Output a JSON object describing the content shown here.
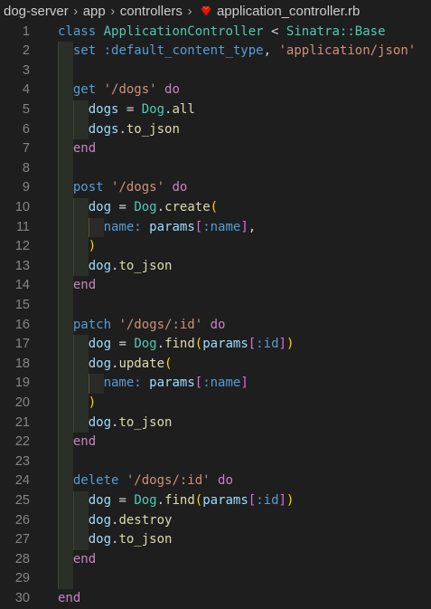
{
  "breadcrumb": {
    "items": [
      "dog-server",
      "app",
      "controllers",
      "application_controller.rb"
    ],
    "separator": ">",
    "file_icon": "ruby-gem-icon",
    "file_icon_color": "#e51400"
  },
  "editor": {
    "language": "ruby",
    "lines": [
      {
        "n": "1",
        "text": "class ApplicationController < Sinatra::Base"
      },
      {
        "n": "2",
        "text": "  set :default_content_type, 'application/json'"
      },
      {
        "n": "3",
        "text": ""
      },
      {
        "n": "4",
        "text": "  get '/dogs' do"
      },
      {
        "n": "5",
        "text": "    dogs = Dog.all"
      },
      {
        "n": "6",
        "text": "    dogs.to_json"
      },
      {
        "n": "7",
        "text": "  end"
      },
      {
        "n": "8",
        "text": ""
      },
      {
        "n": "9",
        "text": "  post '/dogs' do"
      },
      {
        "n": "10",
        "text": "    dog = Dog.create("
      },
      {
        "n": "11",
        "text": "      name: params[:name],"
      },
      {
        "n": "12",
        "text": "    )"
      },
      {
        "n": "13",
        "text": "    dog.to_json"
      },
      {
        "n": "14",
        "text": "  end"
      },
      {
        "n": "15",
        "text": ""
      },
      {
        "n": "16",
        "text": "  patch '/dogs/:id' do"
      },
      {
        "n": "17",
        "text": "    dog = Dog.find(params[:id])"
      },
      {
        "n": "18",
        "text": "    dog.update("
      },
      {
        "n": "19",
        "text": "      name: params[:name]"
      },
      {
        "n": "20",
        "text": "    )"
      },
      {
        "n": "21",
        "text": "    dog.to_json"
      },
      {
        "n": "22",
        "text": "  end"
      },
      {
        "n": "23",
        "text": ""
      },
      {
        "n": "24",
        "text": "  delete '/dogs/:id' do"
      },
      {
        "n": "25",
        "text": "    dog = Dog.find(params[:id])"
      },
      {
        "n": "26",
        "text": "    dog.destroy"
      },
      {
        "n": "27",
        "text": "    dog.to_json"
      },
      {
        "n": "28",
        "text": "  end"
      },
      {
        "n": "29",
        "text": ""
      },
      {
        "n": "30",
        "text": "end"
      }
    ]
  },
  "colors": {
    "background": "#1e1e1e",
    "keyword": "#569cd6",
    "control_keyword": "#c586c0",
    "class_name": "#4ec9b0",
    "string": "#ce9178",
    "function": "#dcdcaa",
    "variable": "#9cdcfe",
    "line_number": "#858585"
  }
}
